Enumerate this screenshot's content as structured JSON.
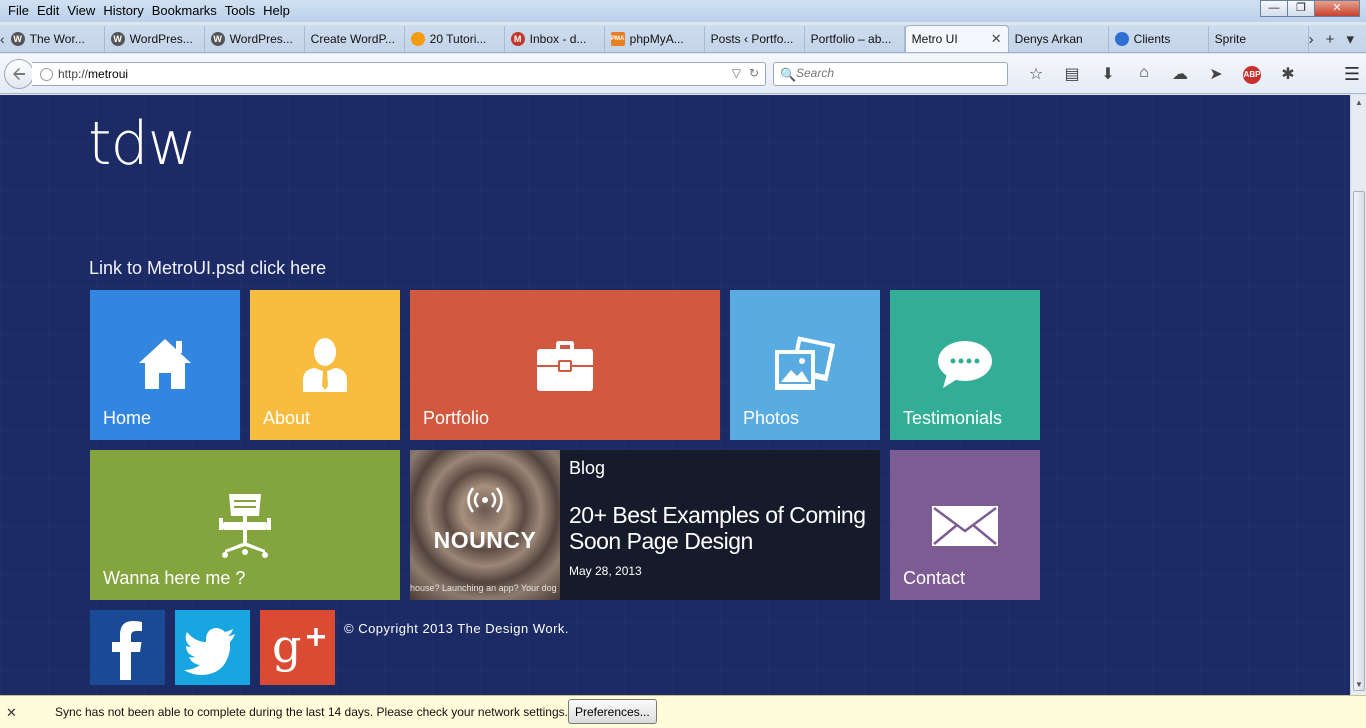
{
  "menu": {
    "items": [
      "File",
      "Edit",
      "View",
      "History",
      "Bookmarks",
      "Tools",
      "Help"
    ],
    "underline": [
      "F",
      "E",
      "V",
      "s",
      "B",
      "T",
      "H"
    ]
  },
  "window_controls": {
    "minimize": "—",
    "restore": "❐",
    "close": "✕"
  },
  "tabs": [
    {
      "label": "The Wor...",
      "icon": "wordpress-icon",
      "badge": "W"
    },
    {
      "label": "WordPres...",
      "icon": "wordpress-icon",
      "badge": "W"
    },
    {
      "label": "WordPres...",
      "icon": "wordpress-icon",
      "badge": "W"
    },
    {
      "label": "Create WordP...",
      "icon": "none",
      "badge": ""
    },
    {
      "label": "20 Tutori...",
      "icon": "tutorial-icon",
      "badge": ""
    },
    {
      "label": "Inbox - d...",
      "icon": "gmail-icon",
      "badge": "M"
    },
    {
      "label": "phpMyA...",
      "icon": "phpmyadmin-icon",
      "badge": "PMA"
    },
    {
      "label": "Posts ‹ Portfo...",
      "icon": "none",
      "badge": ""
    },
    {
      "label": "Portfolio – ab...",
      "icon": "none",
      "badge": ""
    },
    {
      "label": "Metro UI",
      "icon": "none",
      "badge": "",
      "active": true
    },
    {
      "label": "Denys Arkan",
      "icon": "none",
      "badge": ""
    },
    {
      "label": "Clients",
      "icon": "clients-icon",
      "badge": ""
    },
    {
      "label": "Sprite",
      "icon": "none",
      "badge": ""
    }
  ],
  "tab_close_glyph": "✕",
  "tab_tail": {
    "scroll": "›",
    "new_tab": "+",
    "list": "▾"
  },
  "nav": {
    "url_scheme": "http://",
    "url_host": "metroui",
    "search_placeholder": "Search",
    "toolbar_icons": [
      "bookmark-star-icon",
      "reading-list-icon",
      "download-icon",
      "home-icon",
      "sync-icon",
      "share-icon",
      "adblock-plus-icon",
      "addon-icon",
      "hamburger-menu-icon"
    ],
    "abp_label": "ABP"
  },
  "page": {
    "logo": "tdw",
    "psd_link": "Link to MetroUI.psd click here",
    "tiles": {
      "home": "Home",
      "about": "About",
      "portfolio": "Portfolio",
      "photos": "Photos",
      "testimonials": "Testimonials",
      "wanna": "Wanna here me ?",
      "contact": "Contact"
    },
    "blog": {
      "category": "Blog",
      "title": "20+ Best Examples of Coming Soon Page Design",
      "date": "May 28, 2013",
      "thumb_brand": "NOUNCY",
      "thumb_tagline": "house? Launching an app? Your dog"
    },
    "social": [
      "facebook-icon",
      "twitter-icon",
      "google-plus-icon"
    ],
    "copyright": "© Copyright 2013 The Design Work."
  },
  "notification": {
    "message": "Sync has not been able to complete during the last 14 days. Please check your network settings.",
    "button": "Preferences...",
    "close": "✕"
  },
  "colors": {
    "page_bg": "#1c2b66",
    "home": "#3386e0",
    "about": "#f8bd3e",
    "portfolio": "#d25840",
    "photos": "#58ace1",
    "testimonials": "#33ae96",
    "wanna": "#84a43e",
    "blog": "#161b2b",
    "contact": "#7d5b93",
    "facebook": "#1a4a95",
    "twitter": "#17a6e1",
    "google_plus": "#db4a32"
  }
}
